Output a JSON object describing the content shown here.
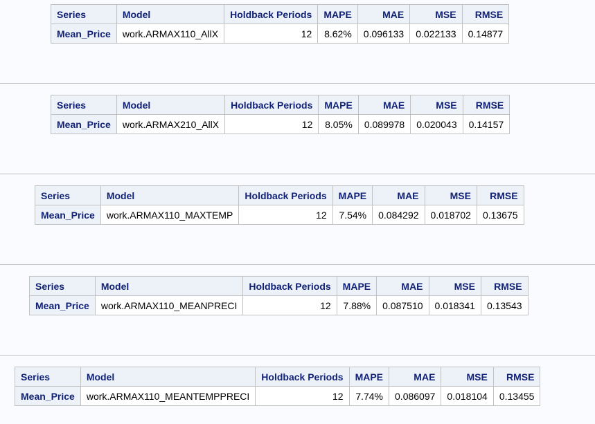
{
  "columns": [
    "Series",
    "Model",
    "Holdback Periods",
    "MAPE",
    "MAE",
    "MSE",
    "RMSE"
  ],
  "tables": [
    {
      "series": "Mean_Price",
      "model": "work.ARMAX110_AllX",
      "holdback": "12",
      "mape": "8.62%",
      "mae": "0.096133",
      "mse": "0.022133",
      "rmse": "0.14877"
    },
    {
      "series": "Mean_Price",
      "model": "work.ARMAX210_AllX",
      "holdback": "12",
      "mape": "8.05%",
      "mae": "0.089978",
      "mse": "0.020043",
      "rmse": "0.14157"
    },
    {
      "series": "Mean_Price",
      "model": "work.ARMAX110_MAXTEMP",
      "holdback": "12",
      "mape": "7.54%",
      "mae": "0.084292",
      "mse": "0.018702",
      "rmse": "0.13675"
    },
    {
      "series": "Mean_Price",
      "model": "work.ARMAX110_MEANPRECI",
      "holdback": "12",
      "mape": "7.88%",
      "mae": "0.087510",
      "mse": "0.018341",
      "rmse": "0.13543"
    },
    {
      "series": "Mean_Price",
      "model": "work.ARMAX110_MEANTEMPPRECI",
      "holdback": "12",
      "mape": "7.74%",
      "mae": "0.086097",
      "mse": "0.018104",
      "rmse": "0.13455"
    }
  ]
}
